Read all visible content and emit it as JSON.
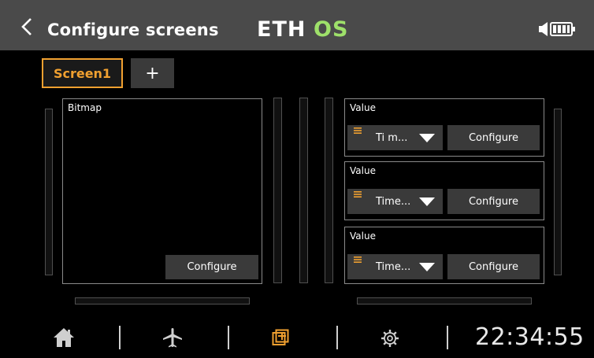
{
  "header": {
    "title": "Configure screens",
    "logo_text": "ETHOS",
    "back_icon": "chevron-left-icon",
    "speaker_icon": "speaker-icon",
    "battery_icon": "battery-icon"
  },
  "tabs": [
    {
      "label": "Screen1",
      "active": true
    },
    {
      "label": "+",
      "active": false
    }
  ],
  "left_widget": {
    "label": "Bitmap",
    "configure_label": "Configure"
  },
  "right_widgets": [
    {
      "label": "Value",
      "source": "Ti m...",
      "configure_label": "Configure"
    },
    {
      "label": "Value",
      "source": "Time...",
      "configure_label": "Configure"
    },
    {
      "label": "Value",
      "source": "Time...",
      "configure_label": "Configure"
    }
  ],
  "bottom_nav": {
    "items": [
      "home-icon",
      "airplane-icon",
      "screens-icon",
      "gear-icon"
    ],
    "active": "screens-icon",
    "clock": "22:34:55"
  },
  "colors": {
    "accent": "#f0a030",
    "header_bg": "#4a4a4a",
    "button_bg": "#3a3a3a",
    "background": "#000000",
    "logo_os": "#9ee06a"
  }
}
